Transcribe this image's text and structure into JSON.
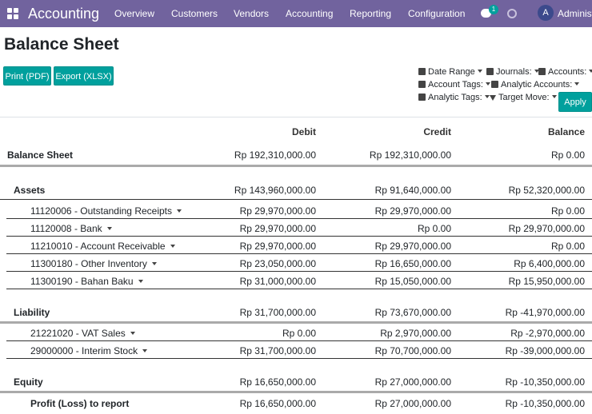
{
  "navbar": {
    "app_name": "Accounting",
    "menu": [
      "Overview",
      "Customers",
      "Vendors",
      "Accounting",
      "Reporting",
      "Configuration"
    ],
    "chat_count": "1",
    "avatar_letter": "A",
    "user_name": "Administ"
  },
  "page": {
    "title": "Balance Sheet",
    "print_label": "Print (PDF)",
    "export_label": "Export (XLSX)",
    "apply_label": "Apply"
  },
  "filters": {
    "date_range": "Date Range",
    "journals": "Journals:",
    "accounts": "Accounts:",
    "account_tags": "Account Tags:",
    "analytic_accounts": "Analytic Accounts:",
    "analytic_tags": "Analytic Tags:",
    "target_move": "Target Move:"
  },
  "table": {
    "headers": {
      "debit": "Debit",
      "credit": "Credit",
      "balance": "Balance"
    },
    "rows": [
      {
        "label": "Balance Sheet",
        "debit": "Rp 192,310,000.00",
        "credit": "Rp 192,310,000.00",
        "balance": "Rp 0.00"
      },
      {
        "label": "Assets",
        "debit": "Rp 143,960,000.00",
        "credit": "Rp 91,640,000.00",
        "balance": "Rp 52,320,000.00"
      },
      {
        "label": "11120006 - Outstanding Receipts",
        "debit": "Rp 29,970,000.00",
        "credit": "Rp 29,970,000.00",
        "balance": "Rp 0.00"
      },
      {
        "label": "11120008 - Bank",
        "debit": "Rp 29,970,000.00",
        "credit": "Rp 0.00",
        "balance": "Rp 29,970,000.00"
      },
      {
        "label": "11210010 - Account Receivable",
        "debit": "Rp 29,970,000.00",
        "credit": "Rp 29,970,000.00",
        "balance": "Rp 0.00"
      },
      {
        "label": "11300180 - Other Inventory",
        "debit": "Rp 23,050,000.00",
        "credit": "Rp 16,650,000.00",
        "balance": "Rp 6,400,000.00"
      },
      {
        "label": "11300190 - Bahan Baku",
        "debit": "Rp 31,000,000.00",
        "credit": "Rp 15,050,000.00",
        "balance": "Rp 15,950,000.00"
      },
      {
        "label": "Liability",
        "debit": "Rp 31,700,000.00",
        "credit": "Rp 73,670,000.00",
        "balance": "Rp -41,970,000.00"
      },
      {
        "label": "21221020 - VAT Sales",
        "debit": "Rp 0.00",
        "credit": "Rp 2,970,000.00",
        "balance": "Rp -2,970,000.00"
      },
      {
        "label": "29000000 - Interim Stock",
        "debit": "Rp 31,700,000.00",
        "credit": "Rp 70,700,000.00",
        "balance": "Rp -39,000,000.00"
      },
      {
        "label": "Equity",
        "debit": "Rp 16,650,000.00",
        "credit": "Rp 27,000,000.00",
        "balance": "Rp -10,350,000.00"
      },
      {
        "label": "Profit (Loss) to report",
        "debit": "Rp 16,650,000.00",
        "credit": "Rp 27,000,000.00",
        "balance": "Rp -10,350,000.00"
      }
    ]
  }
}
